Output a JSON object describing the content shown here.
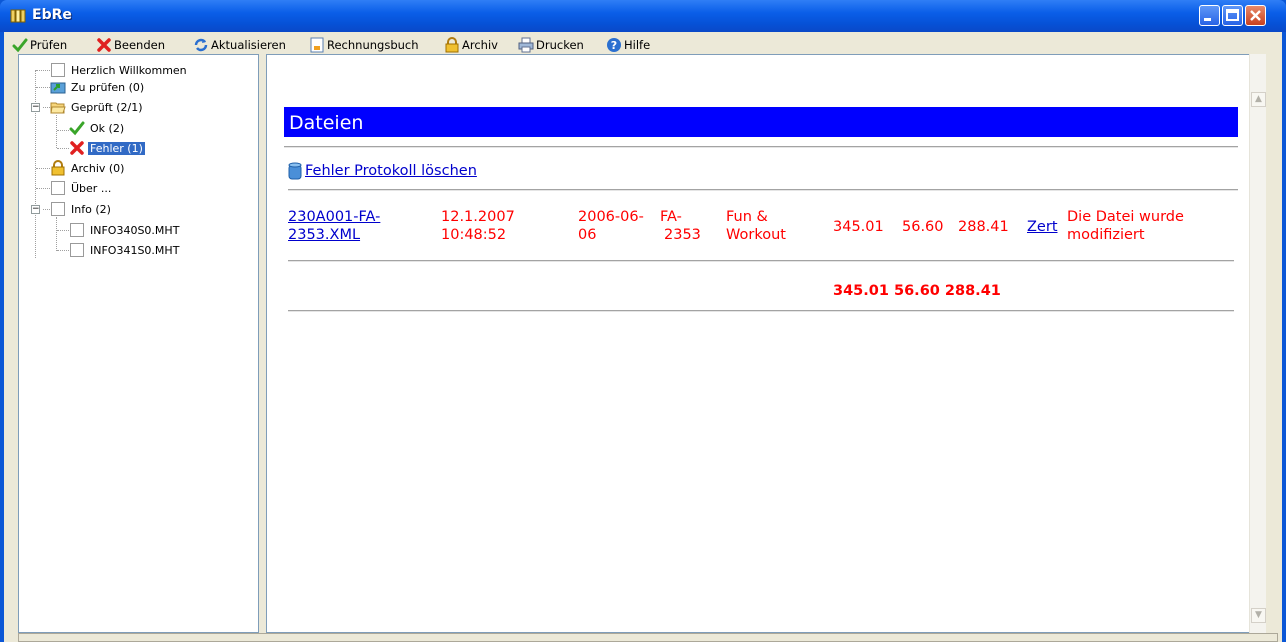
{
  "window": {
    "title": "EbRe"
  },
  "toolbar": {
    "items": [
      {
        "label": "Prüfen",
        "icon": "check-icon"
      },
      {
        "label": "Beenden",
        "icon": "red-x-icon"
      },
      {
        "label": "Aktualisieren",
        "icon": "refresh-icon"
      },
      {
        "label": "Rechnungsbuch",
        "icon": "document-icon"
      },
      {
        "label": "Archiv",
        "icon": "lock-icon"
      },
      {
        "label": "Drucken",
        "icon": "printer-icon"
      },
      {
        "label": "Hilfe",
        "icon": "help-icon"
      }
    ]
  },
  "tree": {
    "nodes": [
      {
        "label": "Herzlich Willkommen",
        "icon": "page-icon"
      },
      {
        "label": "Zu prüfen (0)",
        "icon": "folder-arrow-icon"
      },
      {
        "label": "Geprüft (2/1)",
        "icon": "folder-open-icon",
        "expanded": true
      },
      {
        "label": "Ok (2)",
        "icon": "check-icon"
      },
      {
        "label": "Fehler (1)",
        "icon": "red-x-icon",
        "selected": true
      },
      {
        "label": "Archiv (0)",
        "icon": "lock-icon"
      },
      {
        "label": "Über ...",
        "icon": "page-icon"
      },
      {
        "label": "Info (2)",
        "icon": "page-icon",
        "expanded": true
      },
      {
        "label": "INFO340S0.MHT",
        "icon": "page-icon"
      },
      {
        "label": "INFO341S0.MHT",
        "icon": "page-icon"
      }
    ]
  },
  "main": {
    "header": "Dateien",
    "delete_log_link": "Fehler Protokoll löschen",
    "row": {
      "file": "230A001-FA-2353.XML",
      "file_line1": "230A001-FA-",
      "file_line2": "2353.XML",
      "date_line1": "12.1.2007",
      "date_line2": "10:48:52",
      "invoice_date_line1": "2006-06-",
      "invoice_date_line2": "06",
      "code_line1": "FA-",
      "code_line2": "2353",
      "vendor_line1": "Fun &",
      "vendor_line2": "Workout",
      "amount1": "345.01",
      "amount2": "56.60",
      "amount3": "288.41",
      "cert_link": "Zert",
      "message_line1": "Die Datei wurde",
      "message_line2": "modifiziert"
    },
    "totals": "345.01 56.60 288.41"
  },
  "colors": {
    "header_bg": "#0000ff",
    "error_text": "#ff0000",
    "link": "#0000cc",
    "titlebar": "#0a5ee8",
    "selection": "#316ac5"
  }
}
